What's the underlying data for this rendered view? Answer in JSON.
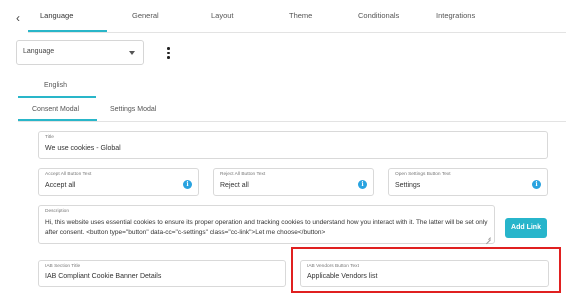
{
  "top_tabs": {
    "back_icon": "chevron-left-icon",
    "items": [
      {
        "label": "Language",
        "active": true
      },
      {
        "label": "General"
      },
      {
        "label": "Layout"
      },
      {
        "label": "Theme"
      },
      {
        "label": "Conditionals"
      },
      {
        "label": "Integrations"
      }
    ],
    "accent_color": "#29b6c9"
  },
  "language_select": {
    "value": "Language",
    "icon": "chevron-down-icon"
  },
  "more_menu": {
    "icon": "kebab-vertical-icon"
  },
  "language_tab": {
    "label": "English"
  },
  "modal_tabs": [
    {
      "label": "Consent Modal",
      "active": true
    },
    {
      "label": "Settings Modal"
    }
  ],
  "fields": {
    "title": {
      "label": "Title",
      "value": "We use cookies - Global"
    },
    "accept_all": {
      "label": "Accept All Button Text",
      "value": "Accept all"
    },
    "reject_all": {
      "label": "Reject All Button Text",
      "value": "Reject all"
    },
    "open_settings": {
      "label": "Open Settings Button Text",
      "value": "Settings"
    },
    "description": {
      "label": "Description",
      "value": "Hi, this website uses essential cookies to ensure its proper operation and tracking cookies to understand how you interact with it. The latter will be set only after consent. <button type=\"button\" data-cc=\"c-settings\" class=\"cc-link\">Let me choose</button>"
    },
    "iab_section_title": {
      "label": "IAB Section Title",
      "value": "IAB Compliant Cookie Banner Details"
    },
    "iab_vendors_button": {
      "label": "IAB Vendors Button Text",
      "value": "Applicable Vendors list"
    }
  },
  "add_link_button": {
    "label": "Add Link"
  },
  "info_icon_color": "#29a3e0",
  "highlight_color": "#e02020"
}
